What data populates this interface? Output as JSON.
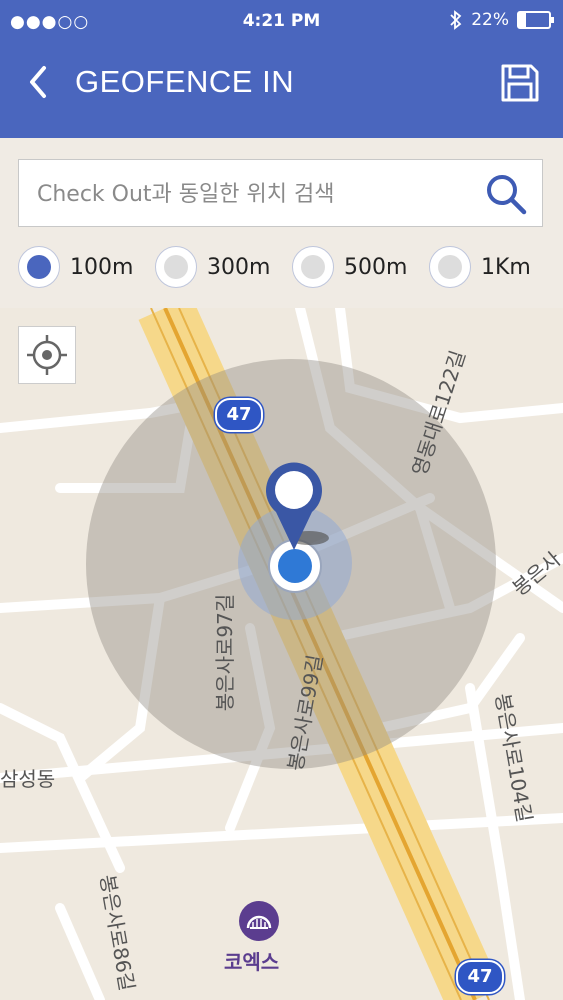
{
  "status_bar": {
    "carrier": "●●●○○",
    "time": "4:21 PM",
    "bluetooth_icon": "bluetooth-icon",
    "battery_percent": "22%",
    "battery_level": 0.22
  },
  "header": {
    "back_icon": "chevron-left-icon",
    "title": "GEOFENCE IN",
    "save_icon": "floppy-disk-icon",
    "background_color": "#4a66be"
  },
  "search": {
    "placeholder": "Check Out과 동일한 위치 검색",
    "search_icon": "magnifier-icon"
  },
  "radius_options": [
    {
      "label": "100m",
      "selected": true
    },
    {
      "label": "300m",
      "selected": false
    },
    {
      "label": "500m",
      "selected": false
    },
    {
      "label": "1Km",
      "selected": false
    }
  ],
  "map": {
    "locate_icon": "crosshair-icon",
    "route_shield": "47",
    "labels": {
      "yeongdong": "영동대로122길",
      "bongeun97": "봉은사로97길",
      "bongeun99": "봉은사로99길",
      "bongeun104": "봉은사로104길",
      "bongeun_right": "봉은사",
      "bongeun86": "봉은사로86길",
      "samseong": "삼성동"
    },
    "poi": {
      "label": "코엑스",
      "icon": "coex-icon"
    },
    "pin_icon": "map-pin-icon",
    "current_location_icon": "current-location-dot-icon"
  }
}
